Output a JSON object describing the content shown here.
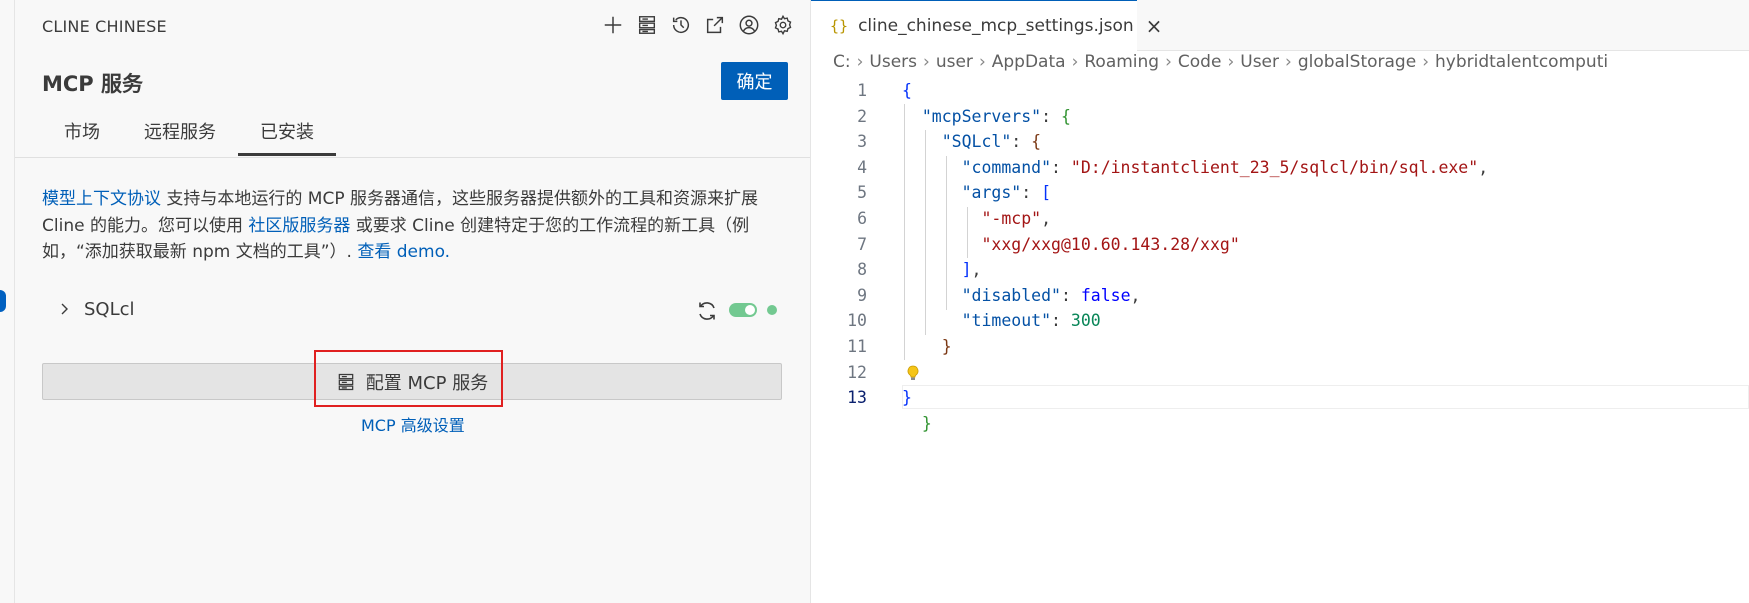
{
  "sidebar": {
    "extension_title": "CLINE CHINESE",
    "toolbar_icons": [
      "plus-icon",
      "server-icon",
      "history-icon",
      "popout-icon",
      "account-icon",
      "gear-icon"
    ],
    "page_title": "MCP 服务",
    "confirm_label": "确定",
    "tabs": [
      {
        "label": "市场",
        "active": false
      },
      {
        "label": "远程服务",
        "active": false
      },
      {
        "label": "已安装",
        "active": true
      }
    ],
    "description": {
      "link1": "模型上下文协议",
      "text1": " 支持与本地运行的 MCP 服务器通信，这些服务器提供额外的工具和资源来扩展 Cline 的能力。您可以使用 ",
      "link2": "社区版服务器",
      "text2": " 或要求 Cline 创建特定于您的工作流程的新工具（例如，“添加获取最新 npm 文档的工具”）. ",
      "link3": "查看 demo."
    },
    "server": {
      "name": "SQLcl",
      "enabled": true,
      "status_color": "#73c991"
    },
    "config_button_label": "配置 MCP 服务",
    "advanced_link": "MCP 高级设置"
  },
  "editor": {
    "tab_icon": "{}",
    "tab_title": "cline_chinese_mcp_settings.json",
    "breadcrumbs": [
      "C:",
      "Users",
      "user",
      "AppData",
      "Roaming",
      "Code",
      "User",
      "globalStorage",
      "hybridtalentcomputi"
    ],
    "line_numbers": [
      "1",
      "2",
      "3",
      "4",
      "5",
      "6",
      "7",
      "8",
      "9",
      "10",
      "11",
      "12",
      "13"
    ],
    "code": {
      "k_mcpServers": "\"mcpServers\"",
      "k_SQLcl": "\"SQLcl\"",
      "k_command": "\"command\"",
      "v_command": "\"D:/instantclient_23_5/sqlcl/bin/sql.exe\"",
      "k_args": "\"args\"",
      "v_arg1": "\"-mcp\"",
      "v_arg2": "\"xxg/xxg@10.60.143.28/xxg\"",
      "k_disabled": "\"disabled\"",
      "v_disabled": "false",
      "k_timeout": "\"timeout\"",
      "v_timeout": "300"
    }
  },
  "colors": {
    "accent": "#005fb8",
    "highlight_box": "#e02020",
    "toggle_on": "#73c991"
  }
}
